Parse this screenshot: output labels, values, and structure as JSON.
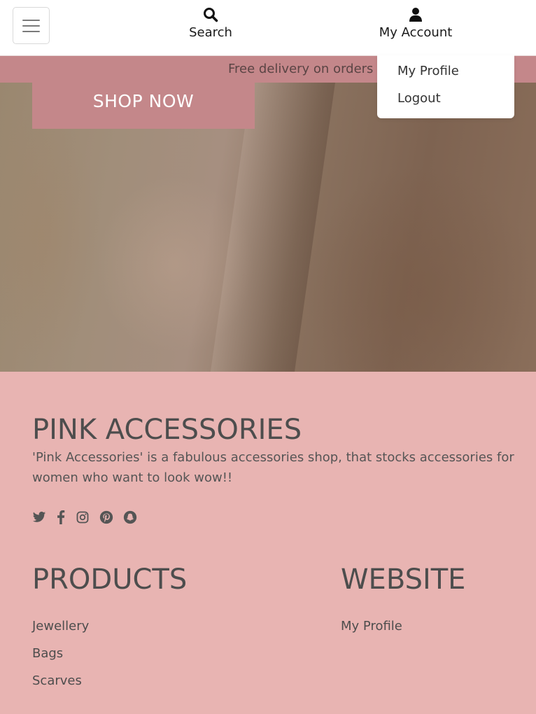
{
  "nav": {
    "menu_icon": "hamburger-icon",
    "search_icon": "search-icon",
    "search_label": "Search",
    "account_icon": "user-icon",
    "account_label": "My Account"
  },
  "account_menu": {
    "items": [
      {
        "label": "My Profile"
      },
      {
        "label": "Logout"
      }
    ]
  },
  "promo": {
    "text": "Free delivery on orders o"
  },
  "hero": {
    "cta_label": "SHOP NOW"
  },
  "footer": {
    "brand_title": "PINK ACCESSORIES",
    "description": "'Pink Accessories' is a fabulous accessories shop, that stocks accessories for women who want to look wow!!",
    "social_icons": [
      "twitter-icon",
      "facebook-icon",
      "instagram-icon",
      "pinterest-icon",
      "snapchat-icon"
    ],
    "products_title": "PRODUCTS",
    "products_links": [
      {
        "label": "Jewellery"
      },
      {
        "label": "Bags"
      },
      {
        "label": "Scarves"
      }
    ],
    "website_title": "WEBSITE",
    "website_links": [
      {
        "label": "My Profile"
      }
    ]
  },
  "colors": {
    "accent": "#c4878a",
    "footer_bg": "#e8b4b2",
    "text": "#4d4d4d"
  }
}
